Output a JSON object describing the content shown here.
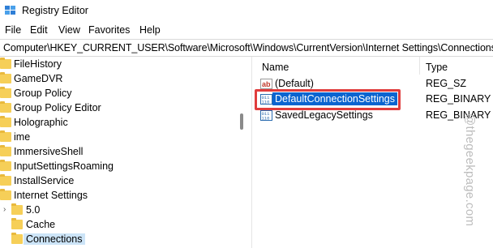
{
  "window": {
    "title": "Registry Editor"
  },
  "menu": {
    "items": [
      "File",
      "Edit",
      "View",
      "Favorites",
      "Help"
    ]
  },
  "address": {
    "path": "Computer\\HKEY_CURRENT_USER\\Software\\Microsoft\\Windows\\CurrentVersion\\Internet Settings\\Connections"
  },
  "tree": {
    "items": [
      {
        "label": "FileHistory"
      },
      {
        "label": "GameDVR"
      },
      {
        "label": "Group Policy"
      },
      {
        "label": "Group Policy Editor"
      },
      {
        "label": "Holographic"
      },
      {
        "label": "ime"
      },
      {
        "label": "ImmersiveShell"
      },
      {
        "label": "InputSettingsRoaming"
      },
      {
        "label": "InstallService"
      },
      {
        "label": "Internet Settings"
      },
      {
        "label": "5.0"
      },
      {
        "label": "Cache"
      },
      {
        "label": "Connections",
        "selected": true
      }
    ]
  },
  "list": {
    "columns": {
      "name": "Name",
      "type": "Type"
    },
    "rows": [
      {
        "name": "(Default)",
        "type": "REG_SZ",
        "icon": "string-value-icon"
      },
      {
        "name": "DefaultConnectionSettings",
        "type": "REG_BINARY",
        "icon": "binary-value-icon",
        "selected": true
      },
      {
        "name": "SavedLegacySettings",
        "type": "REG_BINARY",
        "icon": "binary-value-icon"
      }
    ]
  },
  "watermark": {
    "text": "@thegeekpage.com"
  },
  "colors": {
    "folder": "#f6cf58",
    "selection": "#0a64d0",
    "callout": "#e03c3c"
  }
}
